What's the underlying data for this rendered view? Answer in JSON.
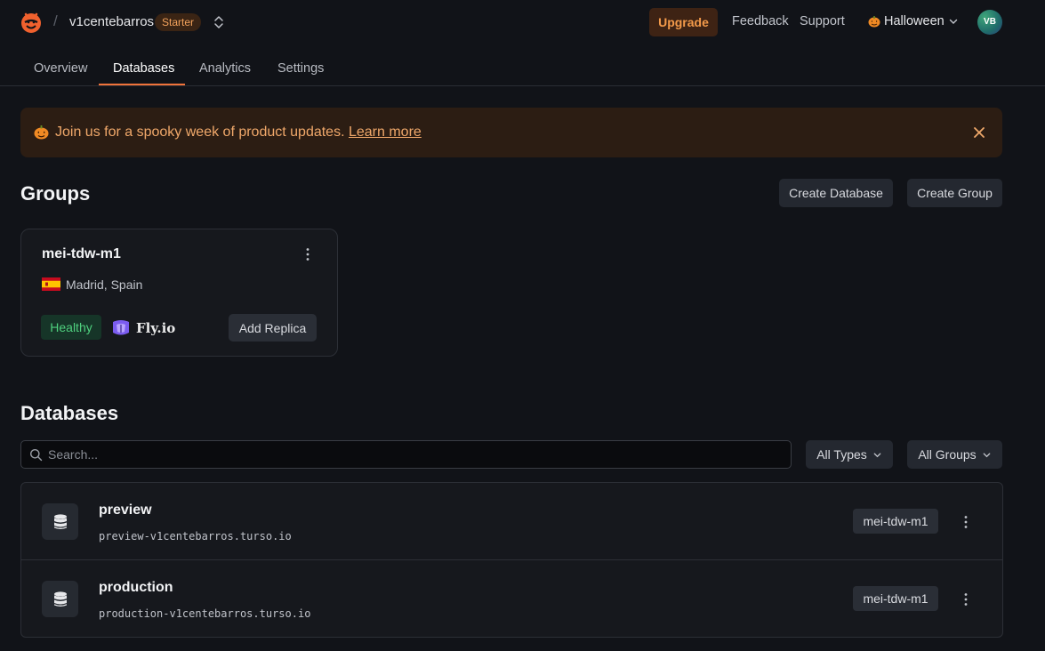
{
  "header": {
    "org_name": "v1centebarros",
    "plan_badge": "Starter",
    "upgrade_label": "Upgrade",
    "feedback_label": "Feedback",
    "support_label": "Support",
    "theme_label": "Halloween",
    "avatar_initials": "VB"
  },
  "tabs": [
    {
      "label": "Overview"
    },
    {
      "label": "Databases",
      "active": true
    },
    {
      "label": "Analytics"
    },
    {
      "label": "Settings"
    }
  ],
  "banner": {
    "text": "Join us for a spooky week of product updates.",
    "link_label": "Learn more"
  },
  "groups": {
    "title": "Groups",
    "create_database_label": "Create Database",
    "create_group_label": "Create Group",
    "items": [
      {
        "name": "mei-tdw-m1",
        "location": "Madrid, Spain",
        "status": "Healthy",
        "provider": "Fly.io",
        "add_replica_label": "Add Replica"
      }
    ]
  },
  "databases": {
    "title": "Databases",
    "search_placeholder": "Search...",
    "filter_types_label": "All Types",
    "filter_groups_label": "All Groups",
    "items": [
      {
        "name": "preview",
        "host": "preview-v1centebarros.turso.io",
        "group": "mei-tdw-m1"
      },
      {
        "name": "production",
        "host": "production-v1centebarros.turso.io",
        "group": "mei-tdw-m1"
      }
    ]
  },
  "colors": {
    "accent": "#f0733a",
    "banner_bg": "#2c1d13",
    "healthy": "#4fd07e"
  }
}
